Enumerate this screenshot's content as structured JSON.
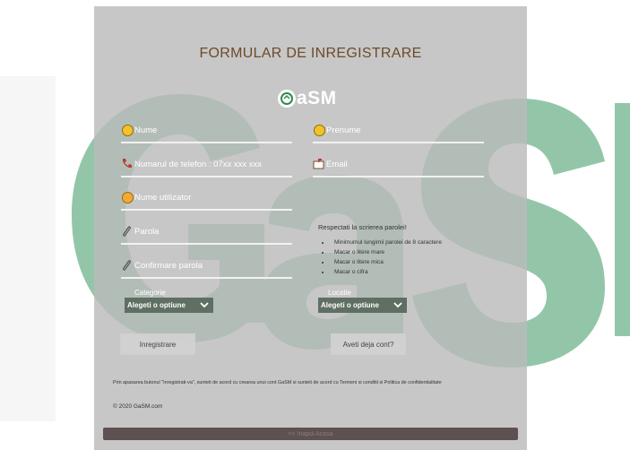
{
  "title": "FORMULAR DE INREGISTRARE",
  "logo_text": "aSM",
  "fields": {
    "nume": "Nume",
    "prenume": "Prenume",
    "telefon": "Numarul de telefon : 07xx xxx xxx",
    "email": "Email",
    "utilizator": "Nume utilizator",
    "parola": "Parola",
    "confirmare": "Confirmare parola"
  },
  "password_rules": {
    "title": "Respectati la scrierea parolei!",
    "items": [
      "Minimumul lungimii parolei de 8 caractere",
      "Macar o litere mare",
      "Macar o litere mica",
      "Macar o cifra"
    ]
  },
  "categorie": {
    "label": "Categorie",
    "value": "Alegeti o optiune"
  },
  "locatie": {
    "label": "Locatie",
    "value": "Alegeti o optiune"
  },
  "buttons": {
    "register": "Inregistrare",
    "have_account": "Aveti deja cont?"
  },
  "terms": {
    "prefix": "Prin apasarea butonul \"Inregistrati-va\", sunteti de acord cu crearea unui cont GaSM si sunteti de acord cu ",
    "link1": "Termeni si conditii",
    "middle": " si ",
    "link2": "Politica de confidentialitate"
  },
  "copyright": "© 2020 GaSM.com",
  "back": "<< Inapoi Acasa",
  "colors": {
    "accent_green": "#8fc4a0",
    "select_bg": "#5f6f63",
    "back_bar": "#5e5151",
    "title": "#6d4a2a"
  }
}
